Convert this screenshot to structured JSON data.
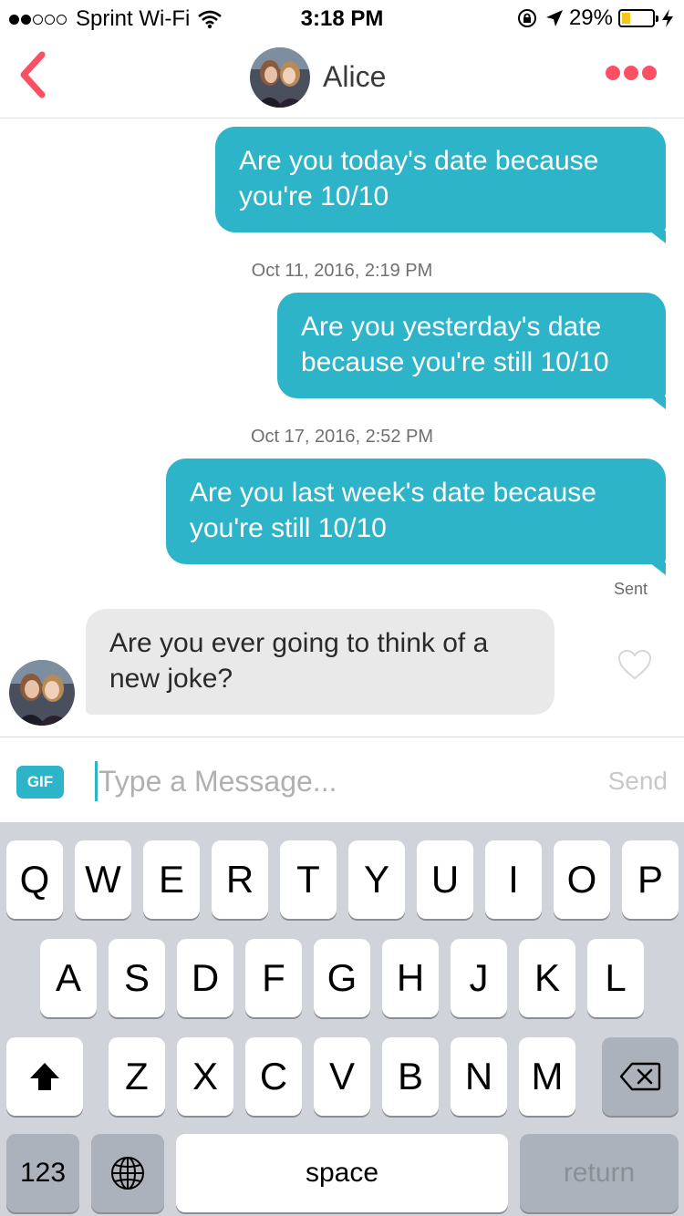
{
  "status_bar": {
    "carrier": "Sprint Wi-Fi",
    "time": "3:18 PM",
    "battery_percent": "29%",
    "battery_level": 0.29,
    "signal_bars_filled": 2,
    "signal_bars_total": 5,
    "icons": [
      "wifi-icon",
      "rotation-lock-icon",
      "location-arrow-icon",
      "battery-icon",
      "charging-bolt-icon"
    ]
  },
  "header": {
    "contact_name": "Alice",
    "back_icon": "chevron-left-icon",
    "more_icon": "more-dots-icon",
    "accent_color": "#fd4f63"
  },
  "messages": [
    {
      "direction": "outgoing",
      "text": "Are you today's date because you're 10/10"
    },
    {
      "type": "timestamp",
      "text": "Oct 11, 2016, 2:19 PM"
    },
    {
      "direction": "outgoing",
      "text": "Are you yesterday's date because you're still 10/10"
    },
    {
      "type": "timestamp",
      "text": "Oct 17, 2016, 2:52 PM"
    },
    {
      "direction": "outgoing",
      "text": "Are you last week's date because you're still 10/10"
    },
    {
      "type": "status",
      "text": "Sent"
    },
    {
      "direction": "incoming",
      "text": "Are you ever going to think of a new joke?",
      "liked": false
    }
  ],
  "colors": {
    "outgoing_bubble": "#2eb4c8",
    "incoming_bubble": "#e9e9ea"
  },
  "composer": {
    "gif_label": "GIF",
    "placeholder": "Type a Message...",
    "value": "",
    "send_label": "Send"
  },
  "keyboard": {
    "row1": [
      "Q",
      "W",
      "E",
      "R",
      "T",
      "Y",
      "U",
      "I",
      "O",
      "P"
    ],
    "row2": [
      "A",
      "S",
      "D",
      "F",
      "G",
      "H",
      "J",
      "K",
      "L"
    ],
    "row3": [
      "Z",
      "X",
      "C",
      "V",
      "B",
      "N",
      "M"
    ],
    "numbers_label": "123",
    "space_label": "space",
    "return_label": "return",
    "shift_icon": "shift-arrow-icon",
    "globe_icon": "globe-icon",
    "delete_icon": "backspace-icon"
  }
}
